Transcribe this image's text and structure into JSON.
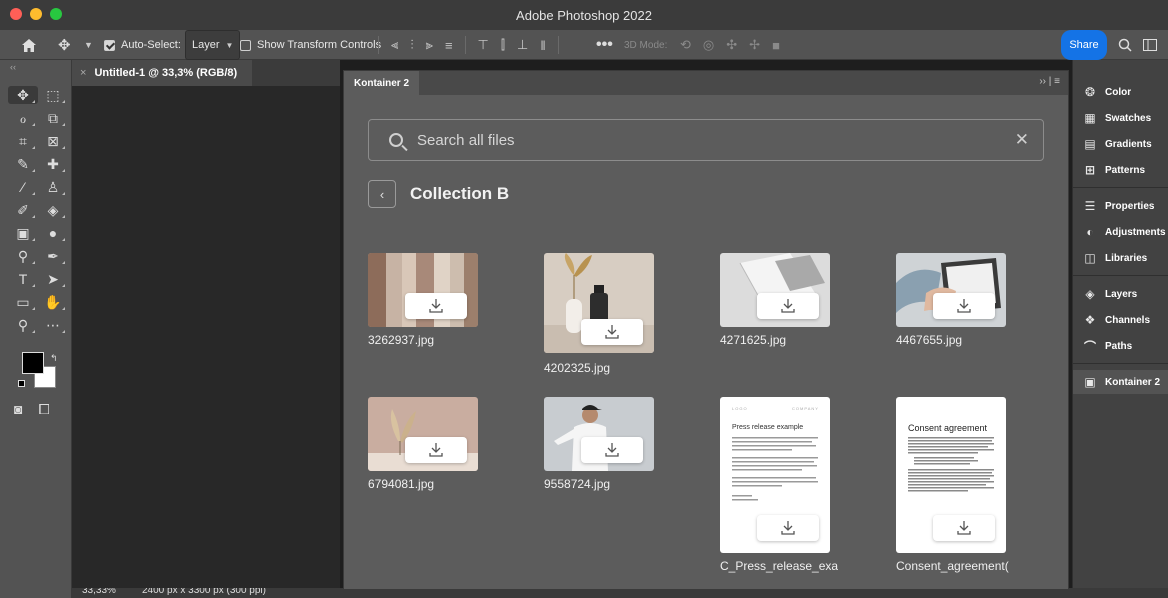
{
  "window": {
    "title": "Adobe Photoshop 2022"
  },
  "options_bar": {
    "auto_select_label": "Auto-Select:",
    "auto_select_value": "Layer",
    "show_transform_label": "Show Transform Controls",
    "mode_3d_label": "3D Mode:",
    "share_label": "Share"
  },
  "document": {
    "tab_title": "Untitled-1 @ 33,3% (RGB/8)",
    "zoom": "33,33%",
    "dimensions": "2400 px x 3300 px (300 ppi)"
  },
  "kontainer": {
    "tab_label": "Kontainer 2",
    "search_placeholder": "Search all files",
    "collection_title": "Collection B",
    "files": [
      {
        "name": "3262937.jpg"
      },
      {
        "name": "4202325.jpg"
      },
      {
        "name": "4271625.jpg"
      },
      {
        "name": "4467655.jpg"
      },
      {
        "name": "6794081.jpg"
      },
      {
        "name": "9558724.jpg"
      },
      {
        "name": "C_Press_release_exai",
        "doc_title": "Press release example",
        "doc_logo": "LOGO",
        "doc_company": "COMPANY"
      },
      {
        "name": "Consent_agreement(",
        "doc_title": "Consent agreement"
      }
    ]
  },
  "right_panels": [
    {
      "label": "Color",
      "icon": "color-icon"
    },
    {
      "label": "Swatches",
      "icon": "swatches-icon"
    },
    {
      "label": "Gradients",
      "icon": "gradients-icon"
    },
    {
      "label": "Patterns",
      "icon": "patterns-icon"
    },
    {
      "label": "Properties",
      "icon": "properties-icon"
    },
    {
      "label": "Adjustments",
      "icon": "adjustments-icon"
    },
    {
      "label": "Libraries",
      "icon": "libraries-icon"
    },
    {
      "label": "Layers",
      "icon": "layers-icon"
    },
    {
      "label": "Channels",
      "icon": "channels-icon"
    },
    {
      "label": "Paths",
      "icon": "paths-icon"
    },
    {
      "label": "Kontainer 2",
      "icon": "kontainer-icon"
    }
  ],
  "colors": {
    "accent": "#1473e6",
    "foreground_color": "#000000",
    "background_color": "#ffffff"
  }
}
